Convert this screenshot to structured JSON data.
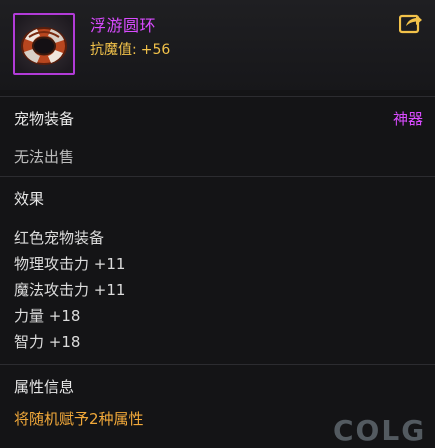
{
  "item": {
    "name": "浮游圆环",
    "stat_label": "抗魔值:",
    "stat_value": "+56",
    "rarity_color": "#d94bff",
    "icon": "life-ring-icon"
  },
  "actions": {
    "share_icon": "share-icon"
  },
  "sections": {
    "category": {
      "label": "宠物装备",
      "rarity": "神器",
      "sell_status": "无法出售"
    },
    "effects": {
      "title": "效果",
      "lines": [
        "红色宠物装备",
        "物理攻击力 +11",
        "魔法攻击力 +11",
        "力量 +18",
        "智力 +18"
      ]
    },
    "attributes": {
      "title": "属性信息",
      "desc": "将随机赋予2种属性",
      "desc_color": "#f2a93a"
    }
  },
  "watermark": "COLG"
}
